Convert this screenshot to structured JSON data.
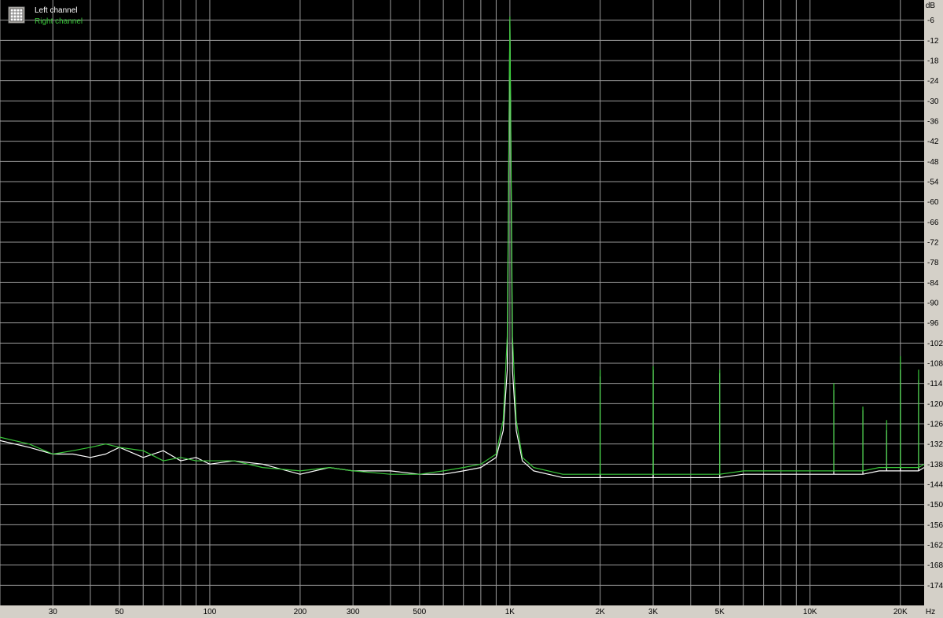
{
  "chart_data": {
    "type": "line",
    "x_scale": "log",
    "xlim": [
      20,
      24000
    ],
    "ylim": [
      -180,
      0
    ],
    "xunit": "Hz",
    "yunit": "dB",
    "x_ticks": [
      {
        "value": 30,
        "label": "30"
      },
      {
        "value": 50,
        "label": "50"
      },
      {
        "value": 100,
        "label": "100"
      },
      {
        "value": 200,
        "label": "200"
      },
      {
        "value": 300,
        "label": "300"
      },
      {
        "value": 500,
        "label": "500"
      },
      {
        "value": 1000,
        "label": "1K"
      },
      {
        "value": 2000,
        "label": "2K"
      },
      {
        "value": 3000,
        "label": "3K"
      },
      {
        "value": 5000,
        "label": "5K"
      },
      {
        "value": 10000,
        "label": "10K"
      },
      {
        "value": 20000,
        "label": "20K"
      }
    ],
    "y_ticks": [
      -6,
      -12,
      -18,
      -24,
      -30,
      -36,
      -42,
      -48,
      -54,
      -60,
      -66,
      -72,
      -78,
      -84,
      -90,
      -96,
      -102,
      -108,
      -114,
      -120,
      -126,
      -132,
      -138,
      -144,
      -150,
      -156,
      -162,
      -168,
      -174
    ],
    "grid": true,
    "legend_position": "top-left",
    "series": [
      {
        "name": "Left channel",
        "color": "#ffffff",
        "points": [
          [
            20,
            -131
          ],
          [
            25,
            -133
          ],
          [
            30,
            -135
          ],
          [
            35,
            -135
          ],
          [
            40,
            -136
          ],
          [
            45,
            -135
          ],
          [
            50,
            -133
          ],
          [
            60,
            -136
          ],
          [
            70,
            -134
          ],
          [
            80,
            -137
          ],
          [
            90,
            -136
          ],
          [
            100,
            -138
          ],
          [
            120,
            -137
          ],
          [
            150,
            -138
          ],
          [
            200,
            -141
          ],
          [
            250,
            -139
          ],
          [
            300,
            -140
          ],
          [
            400,
            -140
          ],
          [
            500,
            -141
          ],
          [
            600,
            -141
          ],
          [
            700,
            -140
          ],
          [
            800,
            -139
          ],
          [
            900,
            -136
          ],
          [
            950,
            -128
          ],
          [
            980,
            -110
          ],
          [
            1000,
            -6
          ],
          [
            1020,
            -110
          ],
          [
            1050,
            -128
          ],
          [
            1100,
            -137
          ],
          [
            1200,
            -140
          ],
          [
            1500,
            -142
          ],
          [
            1999,
            -142
          ],
          [
            2000,
            -112
          ],
          [
            2001,
            -142
          ],
          [
            2500,
            -142
          ],
          [
            2999,
            -142
          ],
          [
            3000,
            -110
          ],
          [
            3001,
            -142
          ],
          [
            4000,
            -142
          ],
          [
            4999,
            -142
          ],
          [
            5000,
            -111
          ],
          [
            5001,
            -142
          ],
          [
            6000,
            -141
          ],
          [
            7000,
            -141
          ],
          [
            8000,
            -141
          ],
          [
            9999,
            -141
          ],
          [
            10000,
            -141
          ],
          [
            11999,
            -141
          ],
          [
            12000,
            -116
          ],
          [
            12001,
            -141
          ],
          [
            14999,
            -141
          ],
          [
            15000,
            -122
          ],
          [
            15001,
            -141
          ],
          [
            17000,
            -140
          ],
          [
            17999,
            -140
          ],
          [
            18000,
            -128
          ],
          [
            18001,
            -140
          ],
          [
            19999,
            -140
          ],
          [
            20000,
            -110
          ],
          [
            20001,
            -140
          ],
          [
            22999,
            -140
          ],
          [
            23000,
            -113
          ],
          [
            23001,
            -140
          ],
          [
            24000,
            -139
          ]
        ]
      },
      {
        "name": "Right channel",
        "color": "#39c63a",
        "points": [
          [
            20,
            -130
          ],
          [
            25,
            -132
          ],
          [
            30,
            -135
          ],
          [
            35,
            -134
          ],
          [
            40,
            -133
          ],
          [
            45,
            -132
          ],
          [
            50,
            -133
          ],
          [
            60,
            -134
          ],
          [
            70,
            -137
          ],
          [
            80,
            -136
          ],
          [
            90,
            -137
          ],
          [
            100,
            -137
          ],
          [
            120,
            -137
          ],
          [
            150,
            -139
          ],
          [
            200,
            -140
          ],
          [
            250,
            -139
          ],
          [
            300,
            -140
          ],
          [
            400,
            -141
          ],
          [
            500,
            -141
          ],
          [
            600,
            -140
          ],
          [
            700,
            -139
          ],
          [
            800,
            -138
          ],
          [
            900,
            -135
          ],
          [
            950,
            -125
          ],
          [
            980,
            -100
          ],
          [
            1000,
            -5
          ],
          [
            1020,
            -100
          ],
          [
            1050,
            -125
          ],
          [
            1100,
            -136
          ],
          [
            1200,
            -139
          ],
          [
            1500,
            -141
          ],
          [
            1999,
            -141
          ],
          [
            2000,
            -110
          ],
          [
            2001,
            -141
          ],
          [
            2500,
            -141
          ],
          [
            2999,
            -141
          ],
          [
            3000,
            -109
          ],
          [
            3001,
            -141
          ],
          [
            4000,
            -141
          ],
          [
            4999,
            -141
          ],
          [
            5000,
            -110
          ],
          [
            5001,
            -141
          ],
          [
            6000,
            -140
          ],
          [
            7000,
            -140
          ],
          [
            8000,
            -140
          ],
          [
            9999,
            -140
          ],
          [
            10000,
            -140
          ],
          [
            11999,
            -140
          ],
          [
            12000,
            -114
          ],
          [
            12001,
            -140
          ],
          [
            14999,
            -140
          ],
          [
            15000,
            -121
          ],
          [
            15001,
            -140
          ],
          [
            17000,
            -139
          ],
          [
            17999,
            -139
          ],
          [
            18000,
            -125
          ],
          [
            18001,
            -139
          ],
          [
            19999,
            -139
          ],
          [
            20000,
            -106
          ],
          [
            20001,
            -139
          ],
          [
            22999,
            -139
          ],
          [
            23000,
            -110
          ],
          [
            23001,
            -139
          ],
          [
            24000,
            -138
          ]
        ]
      }
    ]
  }
}
